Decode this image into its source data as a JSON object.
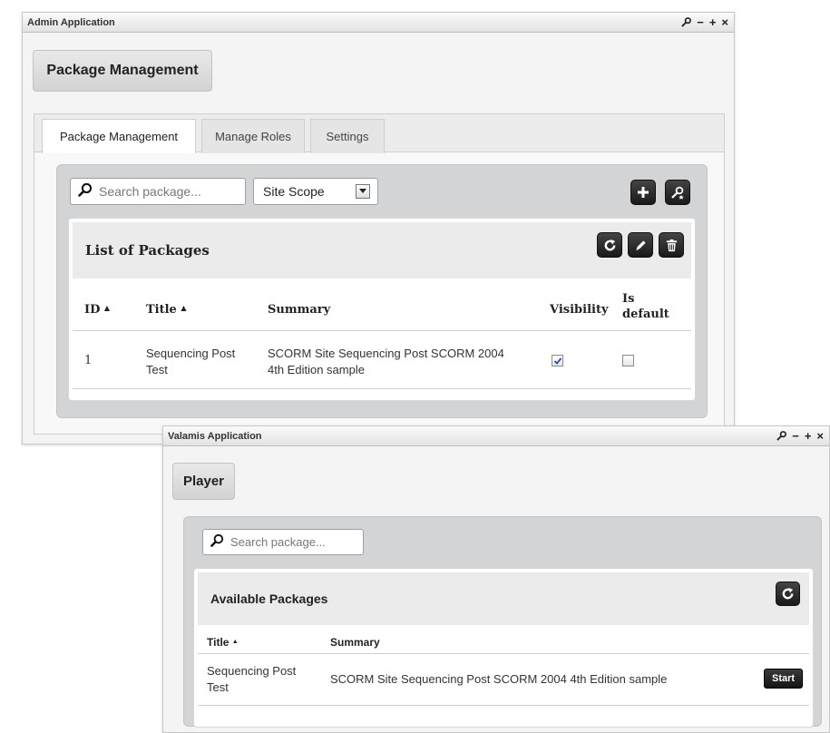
{
  "admin": {
    "window_title": "Admin Application",
    "header_button": "Package Management",
    "tabs": [
      {
        "label": "Package Management",
        "active": true
      },
      {
        "label": "Manage Roles",
        "active": false
      },
      {
        "label": "Settings",
        "active": false
      }
    ],
    "search_placeholder": "Search package...",
    "scope_select": "Site Scope",
    "list_title": "List of Packages",
    "columns": {
      "id": "ID",
      "title": "Title",
      "summary": "Summary",
      "visibility": "Visibility",
      "is_default_line1": "Is",
      "is_default_line2": "default"
    },
    "rows": [
      {
        "id": "1",
        "title_line1": "Sequencing Post",
        "title_line2": "Test",
        "summary_line1": "SCORM Site Sequencing Post SCORM 2004",
        "summary_line2": "4th Edition sample",
        "visibility": true,
        "is_default": false
      }
    ]
  },
  "valamis": {
    "window_title": "Valamis Application",
    "header_button": "Player",
    "search_placeholder": "Search package...",
    "list_title": "Available Packages",
    "columns": {
      "title": "Title",
      "summary": "Summary"
    },
    "rows": [
      {
        "title_line1": "Sequencing Post",
        "title_line2": "Test",
        "summary": "SCORM Site Sequencing Post SCORM 2004 4th Edition sample",
        "action": "Start"
      }
    ]
  },
  "sort_arrow": "▲",
  "window_controls": {
    "minimize": "−",
    "maximize": "+",
    "close": "×"
  },
  "icons": [
    "wrench-icon",
    "search-icon",
    "plus-icon",
    "settings-wrench-icon",
    "refresh-icon",
    "pencil-icon",
    "trash-icon",
    "checkmark-icon",
    "dropdown-arrow-icon"
  ]
}
